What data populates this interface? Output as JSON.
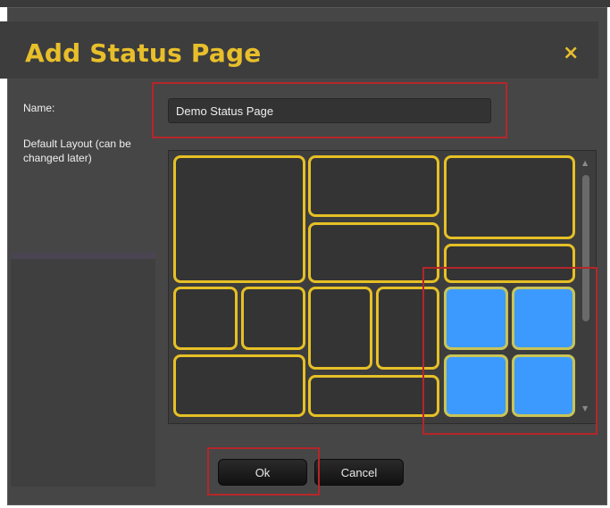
{
  "dialog": {
    "title": "Add Status Page",
    "close_icon": "close-icon",
    "close_glyph": "×"
  },
  "form": {
    "name_label": "Name:",
    "name_value": "Demo Status Page",
    "layout_label": "Default Layout (can be changed later)"
  },
  "layouts": {
    "count": 12,
    "selected_index": 11
  },
  "buttons": {
    "ok_label": "Ok",
    "cancel_label": "Cancel"
  },
  "colors": {
    "title_accent": "#e8bf2b",
    "tile_border": "#e6c026",
    "selected_tile": "#3c9aff",
    "annotation_red": "#b5262a"
  }
}
